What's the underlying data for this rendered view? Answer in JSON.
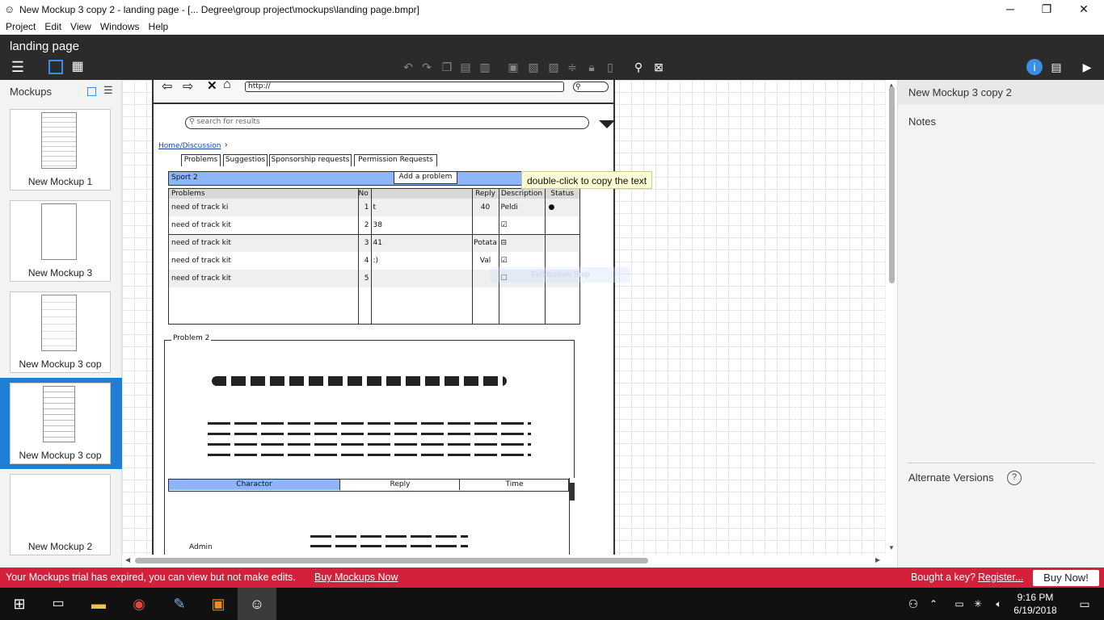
{
  "window": {
    "title": "New Mockup 3 copy 2 - landing page - [... Degree\\group project\\mockups\\landing page.bmpr]",
    "minimize": "─",
    "maximize": "❐",
    "close": "✕"
  },
  "menu": [
    "Project",
    "Edit",
    "View",
    "Windows",
    "Help"
  ],
  "project_title": "landing page",
  "left_panel": {
    "title": "Mockups",
    "items": [
      "New Mockup 1",
      "New Mockup 3",
      "New Mockup 3 cop",
      "New Mockup 3 cop",
      "New Mockup 2"
    ]
  },
  "mockup": {
    "url": "http://",
    "search_placeholder": "search for results",
    "breadcrumb": "Home/Discussion",
    "tabs": [
      "Problems",
      "Suggestios",
      "Sponsorship requests",
      "Permission Requests"
    ],
    "sport_label": "Sport 2",
    "add_button": "Add a problem",
    "table": {
      "headers": [
        "Problems",
        "No",
        "",
        "Reply",
        "Description",
        "Status"
      ],
      "rows": [
        [
          "need of track ki",
          "1",
          "t",
          "40",
          "Peldi",
          "●"
        ],
        [
          "need of track kit",
          "2",
          "38",
          "",
          "☑",
          ""
        ],
        [
          "need of track kit",
          "3",
          "41",
          "Potata",
          "⊟",
          ""
        ],
        [
          "need of track kit",
          "4",
          ":)",
          "Val",
          "☑",
          ""
        ],
        [
          "need of track kit",
          "5",
          "",
          "",
          "☐",
          ""
        ]
      ]
    },
    "group_title": "Problem 2",
    "lower_tabs": [
      "Charactor",
      "Reply",
      "Time"
    ],
    "admin": "Admin"
  },
  "tooltip": "double-click to copy the text",
  "ghost_text": "Full-screen Snip",
  "right_panel": {
    "title": "New Mockup 3 copy 2",
    "notes": "Notes",
    "alt_versions": "Alternate Versions",
    "help": "?"
  },
  "trial": {
    "message": "Your Mockups trial has expired, you can view but not make edits.",
    "buy_link": "Buy Mockups Now",
    "key_q": "Bought a key?",
    "register": "Register...",
    "buy_button": "Buy Now!"
  },
  "taskbar": {
    "time": "9:16 PM",
    "date": "6/19/2018"
  },
  "colors": {
    "trial": "#d4203a",
    "dark": "#2b2b2b",
    "accent": "#1e7fd4",
    "mock_blue": "#8db5f8"
  }
}
